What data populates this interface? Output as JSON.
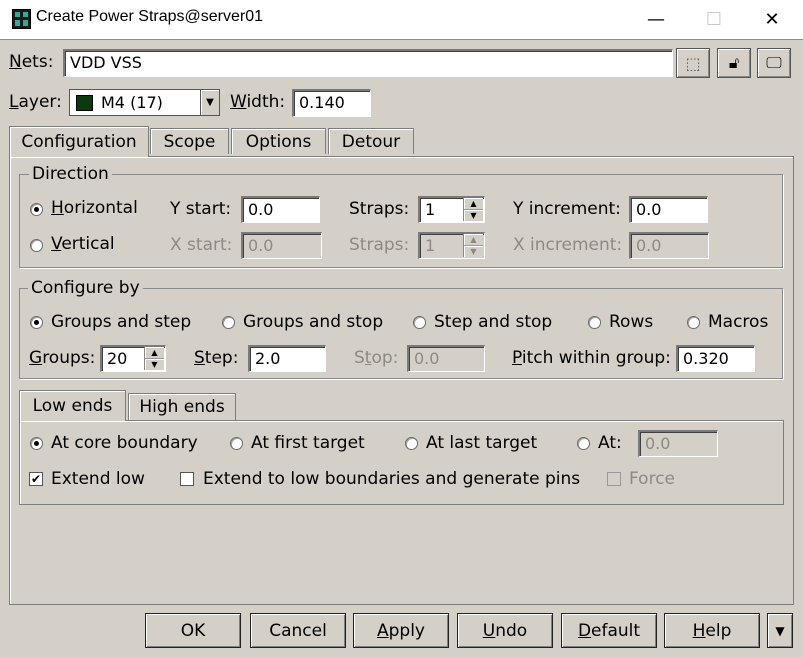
{
  "window": {
    "title": "Create Power Straps@server01",
    "minimize": "—",
    "maximize": "☐",
    "close": "✕"
  },
  "nets": {
    "label": "Nets:",
    "value": "VDD VSS"
  },
  "layer": {
    "label": "Layer:",
    "value": "M4 (17)",
    "swatch_color": "#0c3a0c"
  },
  "width": {
    "label": "Width:",
    "value": "0.140"
  },
  "tabs": [
    "Configuration",
    "Scope",
    "Options",
    "Detour"
  ],
  "direction": {
    "legend": "Direction",
    "horizontal": "Horizontal",
    "vertical": "Vertical",
    "y_start": {
      "label": "Y start:",
      "value": "0.0"
    },
    "x_start": {
      "label": "X start:",
      "value": "0.0"
    },
    "straps_h": {
      "label": "Straps:",
      "value": "1"
    },
    "straps_v": {
      "label": "Straps:",
      "value": "1"
    },
    "y_increment": {
      "label": "Y increment:",
      "value": "0.0"
    },
    "x_increment": {
      "label": "X increment:",
      "value": "0.0"
    }
  },
  "configure_by": {
    "legend": "Configure by",
    "options": [
      "Groups and step",
      "Groups and stop",
      "Step and stop",
      "Rows",
      "Macros"
    ],
    "groups": {
      "label": "Groups:",
      "value": "20"
    },
    "step": {
      "label": "Step:",
      "value": "2.0"
    },
    "stop": {
      "label": "Stop:",
      "value": "0.0"
    },
    "pitch": {
      "label": "Pitch within group:",
      "value": "0.320"
    }
  },
  "ends": {
    "tabs": [
      "Low ends",
      "High ends"
    ],
    "options": [
      "At core boundary",
      "At first target",
      "At last target",
      "At:"
    ],
    "at_value": "0.0",
    "extend_low": "Extend low",
    "extend_to_boundaries": "Extend to low boundaries and generate pins",
    "force": "Force"
  },
  "buttons": {
    "ok": "OK",
    "cancel": "Cancel",
    "apply": "Apply",
    "undo": "Undo",
    "default": "Default",
    "help": "Help"
  }
}
